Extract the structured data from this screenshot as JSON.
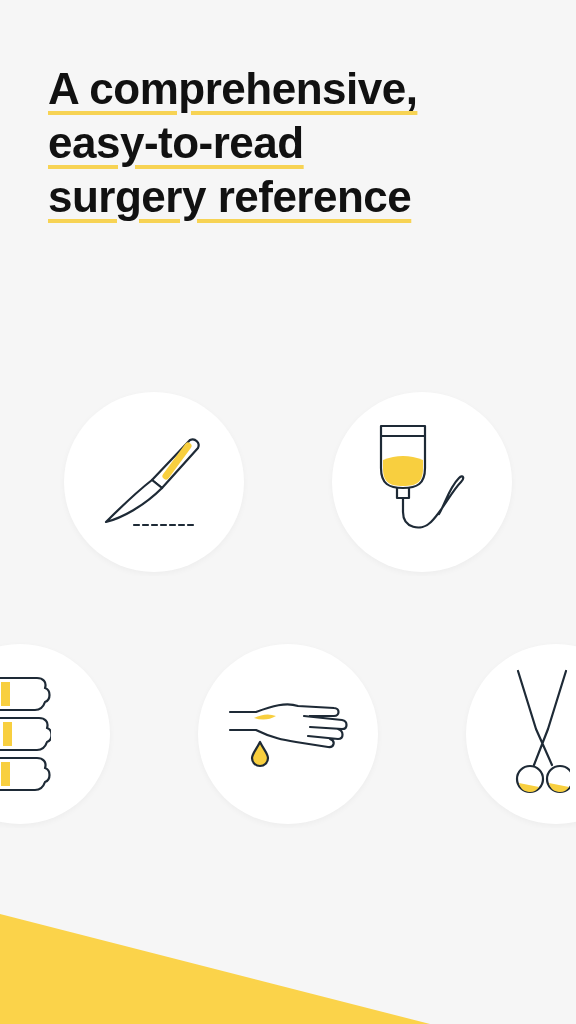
{
  "headline": {
    "lines": [
      "A comprehensive,",
      "easy-to-read",
      "surgery reference"
    ]
  }
}
